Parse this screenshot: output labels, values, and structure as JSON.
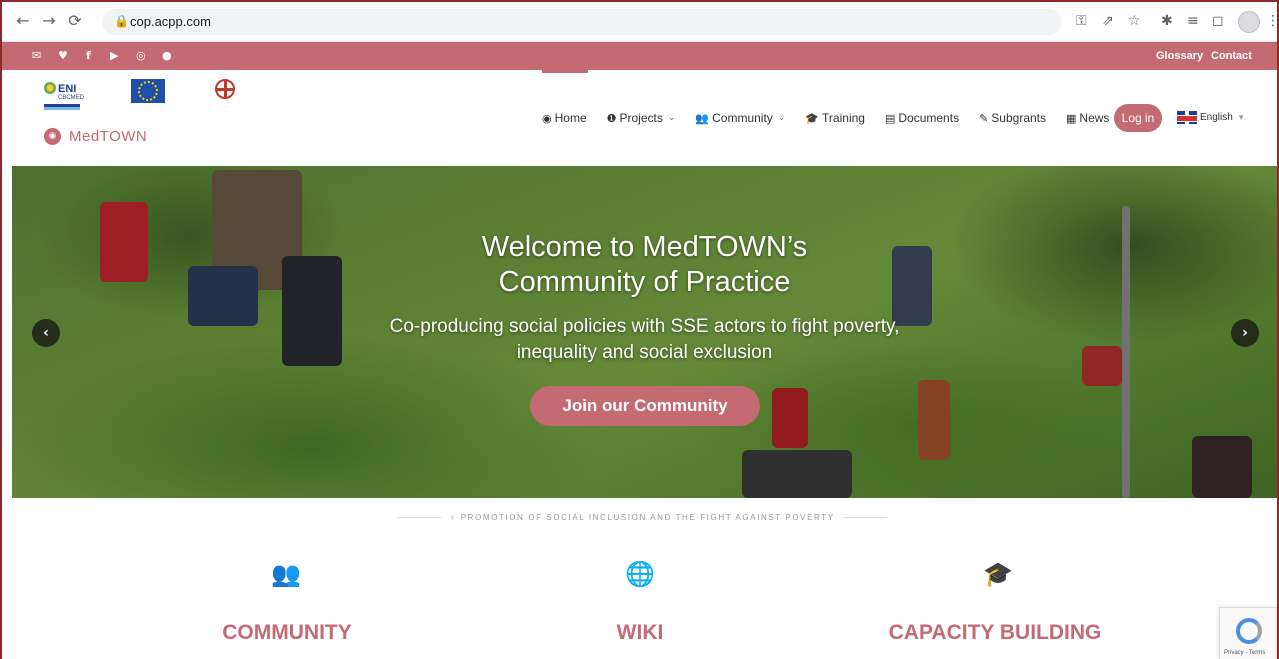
{
  "browser": {
    "url": "cop.acpp.com",
    "icons": [
      "back-icon",
      "forward-icon",
      "reload-icon",
      "lock-icon",
      "key-icon",
      "share-icon",
      "star-icon",
      "extensions-icon",
      "media-icon",
      "sidepanel-icon",
      "profile-icon",
      "menu-icon"
    ]
  },
  "topbar": {
    "social_icons": [
      "mail-icon",
      "twitter-icon",
      "facebook-icon",
      "youtube-icon",
      "instagram-icon",
      "web-icon"
    ],
    "links": [
      "Glossary",
      "Contact"
    ]
  },
  "header": {
    "brand": "MedTOWN",
    "logos": [
      "eni-cbcmed-logo",
      "eu-flag-logo",
      "sardinia-logo"
    ],
    "logo_texts": {
      "eni": "ENI",
      "cbcmed": "CBCMED"
    },
    "menu": [
      {
        "label": "Home",
        "icon": "target-icon",
        "dropdown": false
      },
      {
        "label": "Projects",
        "icon": "info-icon",
        "dropdown": true
      },
      {
        "label": "Community",
        "icon": "users-icon",
        "dropdown": true
      },
      {
        "label": "Training",
        "icon": "graduation-icon",
        "dropdown": false
      },
      {
        "label": "Documents",
        "icon": "document-icon",
        "dropdown": false
      },
      {
        "label": "Subgrants",
        "icon": "edit-icon",
        "dropdown": false
      },
      {
        "label": "News",
        "icon": "newspaper-icon",
        "dropdown": false
      }
    ],
    "login": "Log in",
    "language": "English"
  },
  "hero": {
    "title_line1": "Welcome to MedTOWN’s",
    "title_line2": "Community of Practice",
    "subtitle_line1": "Co-producing social policies with SSE actors to fight poverty,",
    "subtitle_line2": "inequality and social exclusion",
    "cta": "Join our Community"
  },
  "section": {
    "tagline": "PROMOTION OF SOCIAL INCLUSION AND THE FIGHT AGAINST POVERTY",
    "features": [
      {
        "title": "COMMUNITY",
        "icon": "users-icon"
      },
      {
        "title": "WIKI",
        "icon": "globe-network-icon"
      },
      {
        "title": "CAPACITY BUILDING",
        "icon": "graduation-cap-icon"
      }
    ]
  },
  "recaptcha": {
    "text": "Privacy - Terms"
  },
  "colors": {
    "brand": "#c46a72",
    "frame": "#8b2a2a"
  }
}
